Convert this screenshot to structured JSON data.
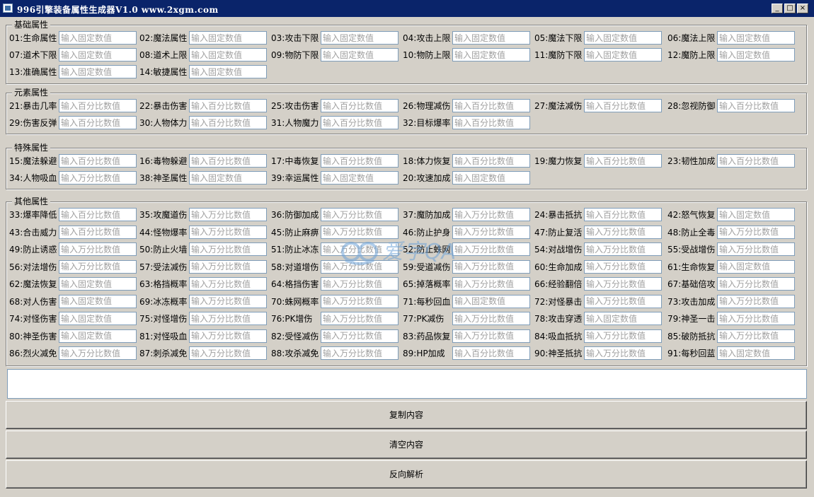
{
  "window": {
    "title": "996引擎装备属性生成器V1.0  www.2xgm.com",
    "controls": [
      "_",
      "□",
      "×"
    ]
  },
  "placeholders": {
    "fixed": "输入固定数值",
    "percent": "输入百分比数值",
    "wan": "输入万分比数值"
  },
  "groups": [
    {
      "title": "基础属性",
      "fields": [
        {
          "label": "01:生命属性",
          "ph": "输入固定数值"
        },
        {
          "label": "02:魔法属性",
          "ph": "输入固定数值"
        },
        {
          "label": "03:攻击下限",
          "ph": "输入固定数值"
        },
        {
          "label": "04:攻击上限",
          "ph": "输入固定数值"
        },
        {
          "label": "05:魔法下限",
          "ph": "输入固定数值"
        },
        {
          "label": "06:魔法上限",
          "ph": "输入固定数值"
        },
        {
          "label": "07:道术下限",
          "ph": "输入固定数值"
        },
        {
          "label": "08:道术上限",
          "ph": "输入固定数值"
        },
        {
          "label": "09:物防下限",
          "ph": "输入固定数值"
        },
        {
          "label": "10:物防上限",
          "ph": "输入固定数值"
        },
        {
          "label": "11:魔防下限",
          "ph": "输入固定数值"
        },
        {
          "label": "12:魔防上限",
          "ph": "输入固定数值"
        },
        {
          "label": "13:准确属性",
          "ph": "输入固定数值"
        },
        {
          "label": "14:敏捷属性",
          "ph": "输入固定数值"
        }
      ]
    },
    {
      "title": "元素属性",
      "fields": [
        {
          "label": "21:暴击几率",
          "ph": "输入百分比数值"
        },
        {
          "label": "22:暴击伤害",
          "ph": "输入百分比数值"
        },
        {
          "label": "25:攻击伤害",
          "ph": "输入百分比数值"
        },
        {
          "label": "26:物理减伤",
          "ph": "输入百分比数值"
        },
        {
          "label": "27:魔法减伤",
          "ph": "输入百分比数值"
        },
        {
          "label": "28:忽视防御",
          "ph": "输入百分比数值"
        },
        {
          "label": "29:伤害反弹",
          "ph": "输入百分比数值"
        },
        {
          "label": "30:人物体力",
          "ph": "输入百分比数值"
        },
        {
          "label": "31:人物魔力",
          "ph": "输入百分比数值"
        },
        {
          "label": "32:目标爆率",
          "ph": "输入百分比数值"
        }
      ]
    },
    {
      "title": "特殊属性",
      "fields": [
        {
          "label": "15:魔法躲避",
          "ph": "输入百分比数值"
        },
        {
          "label": "16:毒物躲避",
          "ph": "输入百分比数值"
        },
        {
          "label": "17:中毒恢复",
          "ph": "输入百分比数值"
        },
        {
          "label": "18:体力恢复",
          "ph": "输入百分比数值"
        },
        {
          "label": "19:魔力恢复",
          "ph": "输入百分比数值"
        },
        {
          "label": "23:韧性加成",
          "ph": "输入百分比数值"
        },
        {
          "label": "34:人物吸血",
          "ph": "输入万分比数值"
        },
        {
          "label": "38:神圣属性",
          "ph": "输入固定数值"
        },
        {
          "label": "39:幸运属性",
          "ph": "输入固定数值"
        },
        {
          "label": "20:攻速加成",
          "ph": "输入固定数值"
        }
      ]
    },
    {
      "title": "其他属性",
      "fields": [
        {
          "label": "33:爆率降低",
          "ph": "输入百分比数值"
        },
        {
          "label": "35:攻魔道伤",
          "ph": "输入万分比数值"
        },
        {
          "label": "36:防御加成",
          "ph": "输入万分比数值"
        },
        {
          "label": "37:魔防加成",
          "ph": "输入万分比数值"
        },
        {
          "label": "24:暴击抵抗",
          "ph": "输入百分比数值"
        },
        {
          "label": "42:怒气恢复",
          "ph": "输入固定数值"
        },
        {
          "label": "43:合击威力",
          "ph": "输入百分比数值"
        },
        {
          "label": "44:怪物爆率",
          "ph": "输入万分比数值"
        },
        {
          "label": "45:防止麻痹",
          "ph": "输入万分比数值"
        },
        {
          "label": "46:防止护身",
          "ph": "输入万分比数值"
        },
        {
          "label": "47:防止复活",
          "ph": "输入万分比数值"
        },
        {
          "label": "48:防止全毒",
          "ph": "输入万分比数值"
        },
        {
          "label": "49:防止诱惑",
          "ph": "输入万分比数值"
        },
        {
          "label": "50:防止火墙",
          "ph": "输入万分比数值"
        },
        {
          "label": "51:防止冰冻",
          "ph": "输入万分比数值"
        },
        {
          "label": "52:防止蛛网",
          "ph": "输入万分比数值"
        },
        {
          "label": "54:对战增伤",
          "ph": "输入万分比数值"
        },
        {
          "label": "55:受战增伤",
          "ph": "输入万分比数值"
        },
        {
          "label": "56:对法增伤",
          "ph": "输入万分比数值"
        },
        {
          "label": "57:受法减伤",
          "ph": "输入万分比数值"
        },
        {
          "label": "58:对道增伤",
          "ph": "输入万分比数值"
        },
        {
          "label": "59:受道减伤",
          "ph": "输入万分比数值"
        },
        {
          "label": "60:生命加成",
          "ph": "输入万分比数值"
        },
        {
          "label": "61:生命恢复",
          "ph": "输入固定数值"
        },
        {
          "label": "62:魔法恢复",
          "ph": "输入固定数值"
        },
        {
          "label": "63:格挡概率",
          "ph": "输入万分比数值"
        },
        {
          "label": "64:格挡伤害",
          "ph": "输入万分比数值"
        },
        {
          "label": "65:掉落概率",
          "ph": "输入万分比数值"
        },
        {
          "label": "66:经验翻倍",
          "ph": "输入万分比数值"
        },
        {
          "label": "67:基础倍攻",
          "ph": "输入万分比数值"
        },
        {
          "label": "68:对人伤害",
          "ph": "输入固定数值"
        },
        {
          "label": "69:冰冻概率",
          "ph": "输入万分比数值"
        },
        {
          "label": "70:蛛网概率",
          "ph": "输入万分比数值"
        },
        {
          "label": "71:每秒回血",
          "ph": "输入固定数值"
        },
        {
          "label": "72:对怪暴击",
          "ph": "输入万分比数值"
        },
        {
          "label": "73:攻击加成",
          "ph": "输入万分比数值"
        },
        {
          "label": "74:对怪伤害",
          "ph": "输入固定数值"
        },
        {
          "label": "75:对怪增伤",
          "ph": "输入万分比数值"
        },
        {
          "label": "76:PK增伤",
          "ph": "输入万分比数值"
        },
        {
          "label": "77:PK减伤",
          "ph": "输入万分比数值"
        },
        {
          "label": "78:攻击穿透",
          "ph": "输入固定数值"
        },
        {
          "label": "79:神圣一击",
          "ph": "输入万分比数值"
        },
        {
          "label": "80:神圣伤害",
          "ph": "输入固定数值"
        },
        {
          "label": "81:对怪吸血",
          "ph": "输入万分比数值"
        },
        {
          "label": "82:受怪减伤",
          "ph": "输入万分比数值"
        },
        {
          "label": "83:药品恢复",
          "ph": "输入万分比数值"
        },
        {
          "label": "84:吸血抵抗",
          "ph": "输入万分比数值"
        },
        {
          "label": "85:破防抵抗",
          "ph": "输入万分比数值"
        },
        {
          "label": "86:烈火减免",
          "ph": "输入万分比数值"
        },
        {
          "label": "87:刺杀减免",
          "ph": "输入万分比数值"
        },
        {
          "label": "88:攻杀减免",
          "ph": "输入万分比数值"
        },
        {
          "label": "89:HP加成",
          "ph": "输入百分比数值"
        },
        {
          "label": "90:神圣抵抗",
          "ph": "输入万分比数值"
        },
        {
          "label": "91:每秒回蓝",
          "ph": "输入固定数值"
        }
      ]
    }
  ],
  "output": {
    "value": ""
  },
  "buttons": {
    "copy": "复制内容",
    "clear": "清空内容",
    "parse": "反向解析"
  },
  "watermark": {
    "text": "爱字QA"
  }
}
